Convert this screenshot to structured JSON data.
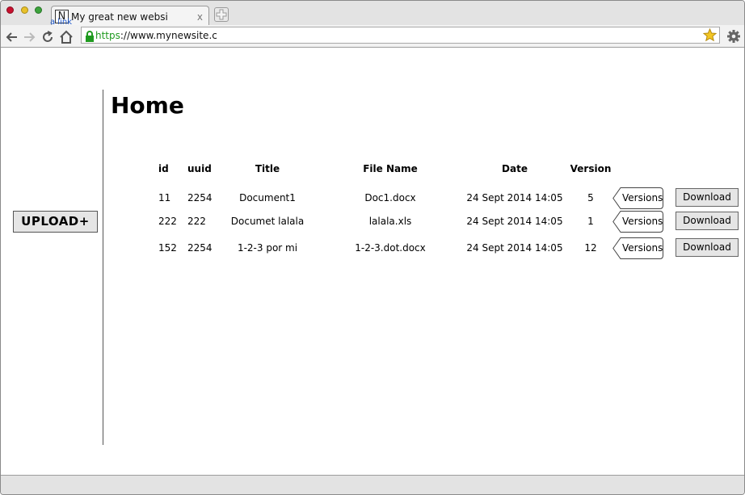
{
  "browser": {
    "tab_title": "My great new websi",
    "tab_close": "x",
    "favicon_letter": "N",
    "tab_link": "a link",
    "url_scheme": "https",
    "url_rest": "://www.mynewsite.c"
  },
  "sidebar": {
    "upload_label": "UPLOAD+"
  },
  "main": {
    "title": "Home",
    "columns": {
      "id": "id",
      "uuid": "uuid",
      "title": "Title",
      "file_name": "File Name",
      "date": "Date",
      "version": "Version"
    },
    "rows": [
      {
        "id": "11",
        "uuid": "2254",
        "title": "Document1",
        "file_name": "Doc1.docx",
        "date": "24 Sept 2014 14:05",
        "version": "5",
        "versions_label": "Versions",
        "download_label": "Download"
      },
      {
        "id": "222",
        "uuid": "222",
        "title": "Documet lalala",
        "file_name": "lalala.xls",
        "date": "24 Sept 2014 14:05",
        "version": "1",
        "versions_label": "Versions",
        "download_label": "Download"
      },
      {
        "id": "152",
        "uuid": "2254",
        "title": "1-2-3 por mi",
        "file_name": "1-2-3.dot.docx",
        "date": "24 Sept 2014 14:05",
        "version": "12",
        "versions_label": "Versions",
        "download_label": "Download"
      }
    ]
  },
  "icons": {
    "back": "arrow-left-icon",
    "forward": "arrow-right-icon",
    "reload": "reload-icon",
    "home": "home-icon",
    "lock": "lock-icon",
    "bookmark": "star-icon",
    "settings": "gear-icon"
  },
  "colors": {
    "link": "#1a55c9",
    "secure": "#1f9a1f",
    "close_dot": "#c8102e",
    "minimize_dot": "#e8c12a",
    "zoom_dot": "#3ca33c"
  }
}
